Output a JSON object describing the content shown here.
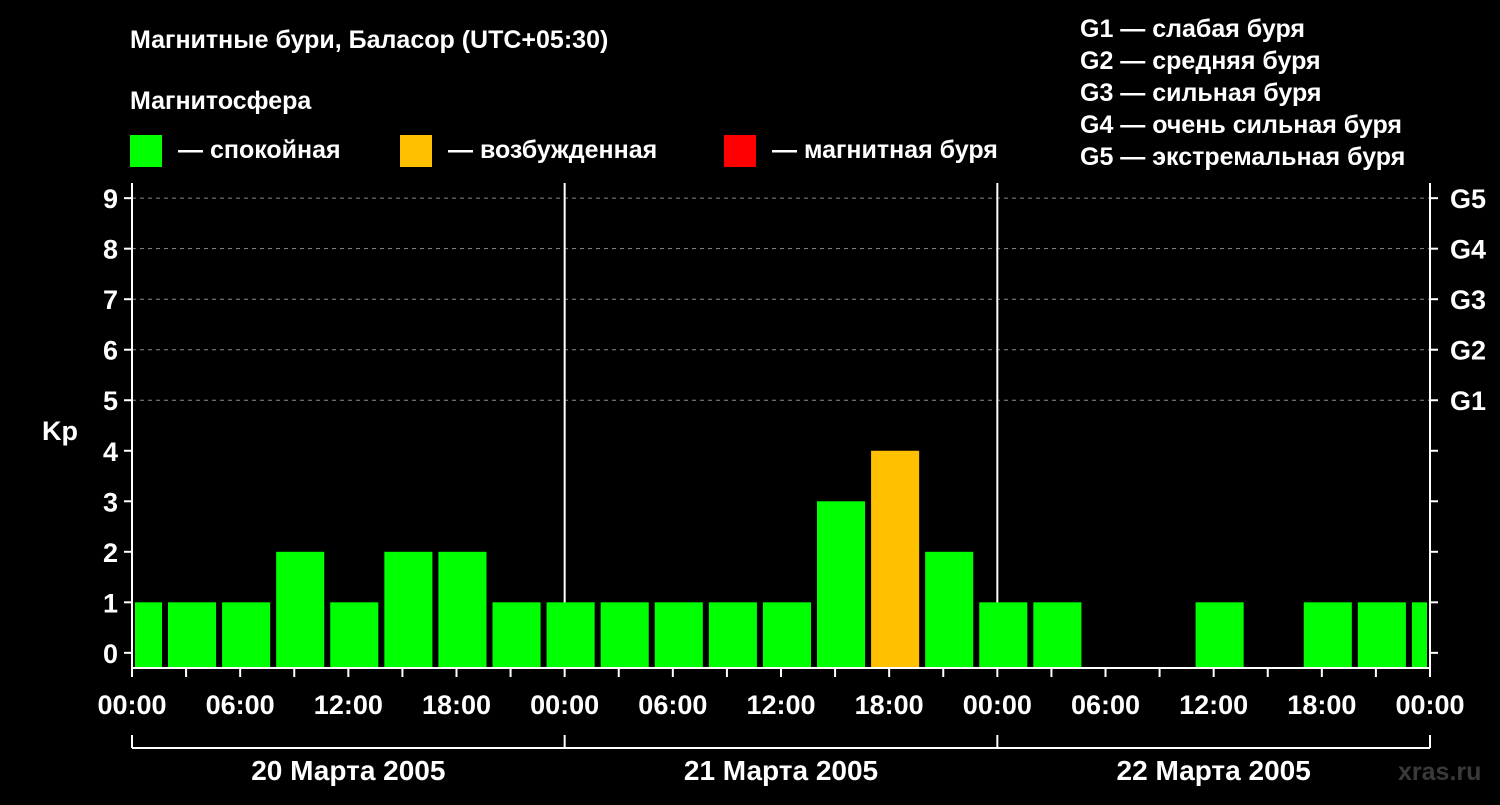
{
  "chart_data": {
    "type": "bar",
    "title": "Магнитные бури, Баласор (UTC+05:30)",
    "legend_title": "Магнитосфера",
    "legend": [
      {
        "key": "quiet",
        "color": "#00ff00",
        "label": "— спокойная"
      },
      {
        "key": "active",
        "color": "#ffc000",
        "label": "— возбужденная"
      },
      {
        "key": "storm",
        "color": "#ff0000",
        "label": "— магнитная буря"
      }
    ],
    "storm_scale": [
      "G1 — слабая буря",
      "G2 — средняя буря",
      "G3 — сильная буря",
      "G4 — очень сильная буря",
      "G5 — экстремальная буря"
    ],
    "ylabel": "Kp",
    "ylim": [
      -0.3,
      9.3
    ],
    "yticks": [
      0,
      1,
      2,
      3,
      4,
      5,
      6,
      7,
      8,
      9
    ],
    "right_ticks": [
      {
        "value": 5,
        "label": "G1"
      },
      {
        "value": 6,
        "label": "G2"
      },
      {
        "value": 7,
        "label": "G3"
      },
      {
        "value": 8,
        "label": "G4"
      },
      {
        "value": 9,
        "label": "G5"
      }
    ],
    "x_range_hours": [
      0,
      72
    ],
    "xtick_labels": [
      {
        "hour": 0,
        "label": "00:00"
      },
      {
        "hour": 6,
        "label": "06:00"
      },
      {
        "hour": 12,
        "label": "12:00"
      },
      {
        "hour": 18,
        "label": "18:00"
      },
      {
        "hour": 24,
        "label": "00:00"
      },
      {
        "hour": 30,
        "label": "06:00"
      },
      {
        "hour": 36,
        "label": "12:00"
      },
      {
        "hour": 42,
        "label": "18:00"
      },
      {
        "hour": 48,
        "label": "00:00"
      },
      {
        "hour": 54,
        "label": "06:00"
      },
      {
        "hour": 60,
        "label": "12:00"
      },
      {
        "hour": 66,
        "label": "18:00"
      },
      {
        "hour": 72,
        "label": "00:00"
      }
    ],
    "days": [
      {
        "label": "20 Марта 2005",
        "start": 0,
        "end": 24
      },
      {
        "label": "21 Марта 2005",
        "start": 24,
        "end": 48
      },
      {
        "label": "22 Марта 2005",
        "start": 48,
        "end": 72
      }
    ],
    "grid": "dashed horizontal at 5, 6, 7, 8, 9",
    "bars": [
      {
        "start": 0,
        "end": 1.83,
        "kp": 1,
        "level": "quiet"
      },
      {
        "start": 1.83,
        "end": 4.83,
        "kp": 1,
        "level": "quiet"
      },
      {
        "start": 4.83,
        "end": 7.83,
        "kp": 1,
        "level": "quiet"
      },
      {
        "start": 7.83,
        "end": 10.83,
        "kp": 2,
        "level": "quiet"
      },
      {
        "start": 10.83,
        "end": 13.83,
        "kp": 1,
        "level": "quiet"
      },
      {
        "start": 13.83,
        "end": 16.83,
        "kp": 2,
        "level": "quiet"
      },
      {
        "start": 16.83,
        "end": 19.83,
        "kp": 2,
        "level": "quiet"
      },
      {
        "start": 19.83,
        "end": 22.83,
        "kp": 1,
        "level": "quiet"
      },
      {
        "start": 22.83,
        "end": 25.83,
        "kp": 1,
        "level": "quiet"
      },
      {
        "start": 25.83,
        "end": 28.83,
        "kp": 1,
        "level": "quiet"
      },
      {
        "start": 28.83,
        "end": 31.83,
        "kp": 1,
        "level": "quiet"
      },
      {
        "start": 31.83,
        "end": 34.83,
        "kp": 1,
        "level": "quiet"
      },
      {
        "start": 34.83,
        "end": 37.83,
        "kp": 1,
        "level": "quiet"
      },
      {
        "start": 37.83,
        "end": 40.83,
        "kp": 3,
        "level": "quiet"
      },
      {
        "start": 40.83,
        "end": 43.83,
        "kp": 4,
        "level": "active"
      },
      {
        "start": 43.83,
        "end": 46.83,
        "kp": 2,
        "level": "quiet"
      },
      {
        "start": 46.83,
        "end": 49.83,
        "kp": 1,
        "level": "quiet"
      },
      {
        "start": 49.83,
        "end": 52.83,
        "kp": 1,
        "level": "quiet"
      },
      {
        "start": 52.83,
        "end": 55.83,
        "kp": 0,
        "level": "quiet"
      },
      {
        "start": 55.83,
        "end": 58.83,
        "kp": 0,
        "level": "quiet"
      },
      {
        "start": 58.83,
        "end": 61.83,
        "kp": 1,
        "level": "quiet"
      },
      {
        "start": 61.83,
        "end": 64.83,
        "kp": 0,
        "level": "quiet"
      },
      {
        "start": 64.83,
        "end": 67.83,
        "kp": 1,
        "level": "quiet"
      },
      {
        "start": 67.83,
        "end": 70.83,
        "kp": 1,
        "level": "quiet"
      },
      {
        "start": 70.83,
        "end": 72,
        "kp": 1,
        "level": "quiet"
      }
    ]
  },
  "watermark": "xras.ru"
}
